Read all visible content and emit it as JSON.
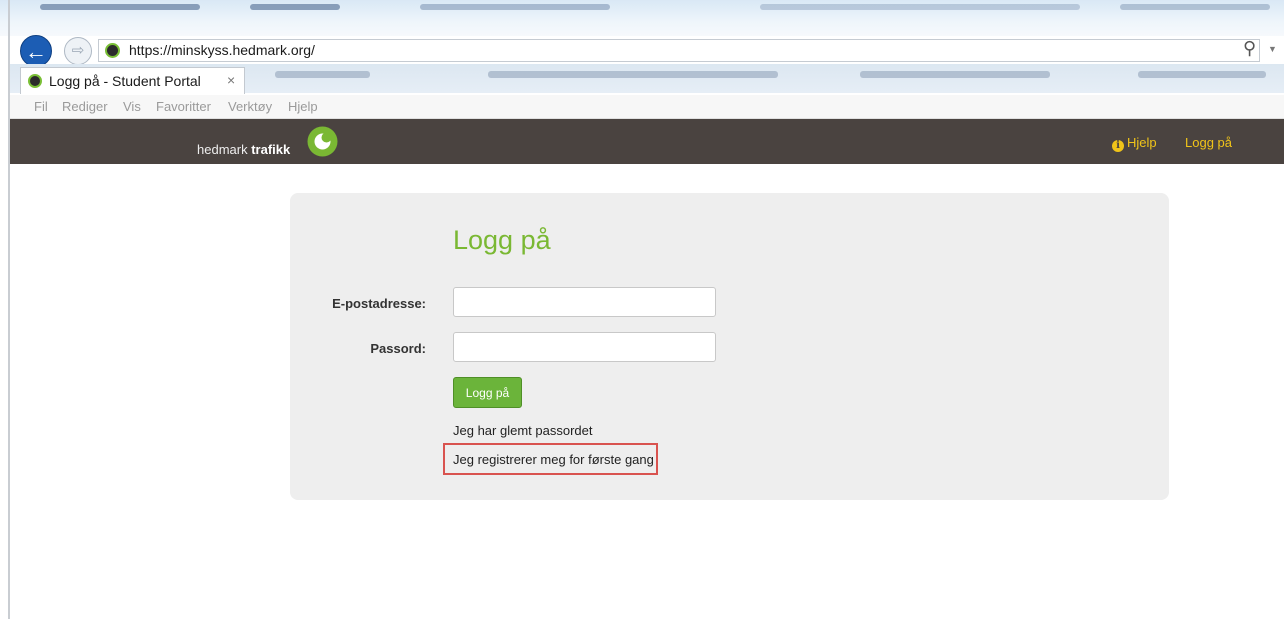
{
  "browser": {
    "url": "https://minskyss.hedmark.org/",
    "active_tab_title": "Logg på - Student Portal",
    "tab_close_glyph": "×",
    "menu": [
      "Fil",
      "Rediger",
      "Vis",
      "Favoritter",
      "Verktøy",
      "Hjelp"
    ]
  },
  "header": {
    "brand_light": "hedmark ",
    "brand_bold": "trafikk",
    "help_label": "Hjelp",
    "login_label": "Logg på",
    "accent_color": "#f0c419",
    "bar_color": "#4a4340"
  },
  "login": {
    "title": "Logg på",
    "email_label": "E-postadresse:",
    "email_value": "",
    "password_label": "Passord:",
    "password_value": "",
    "submit_label": "Logg på",
    "forgot_link": "Jeg har glemt passordet",
    "register_link": "Jeg registrerer meg for første gang",
    "title_color": "#7ab833",
    "button_color": "#6bb43a",
    "highlight_color": "#d9534f"
  }
}
